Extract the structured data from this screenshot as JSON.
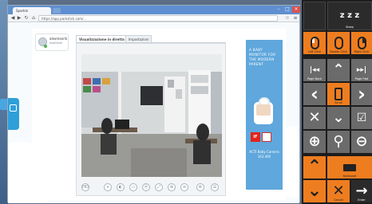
{
  "browser": {
    "tab_title": "Sparkle",
    "url": "https://app.parkstick.com/...",
    "window_controls": [
      "–",
      "□",
      "×"
    ],
    "nav": {
      "back": "◀",
      "forward": "▶",
      "reload": "↻",
      "home": "⌂"
    },
    "menu_icon": "≡"
  },
  "profile": {
    "name": "alexmanrik",
    "status": "Available"
  },
  "tabs": [
    "Visualizzazione in diretta",
    "Impostazioni"
  ],
  "video_controls": [
    "HD",
    "⏸",
    "◐",
    "▭",
    "⦿",
    "⤢",
    "⊕",
    "≡",
    "⚙",
    "☰"
  ],
  "ad": {
    "headline": "A BABY MONITOR FOR THE MODERN PARENT",
    "badge": "iF",
    "price_text": "ACTI Baby Camera 163.40€"
  },
  "panel": {
    "sleep": {
      "label": "z z z",
      "sub": "Sleep"
    },
    "left_click": {
      "sub": "Left Click"
    },
    "double_click": {
      "sub": "Double Click"
    },
    "right_click": {
      "sub": "Right Click"
    },
    "page_back": {
      "glyph": "|◂◂",
      "sub": "Page Back"
    },
    "up": {
      "glyph": "⌃"
    },
    "page_forward": {
      "glyph": "▸▸|",
      "sub": "Page Fwd"
    },
    "left": {
      "glyph": "‹"
    },
    "scroll": {
      "sub": "Scroll"
    },
    "right": {
      "glyph": "›"
    },
    "close": {
      "glyph": "✕"
    },
    "down": {
      "glyph": "⌄"
    },
    "check": {
      "glyph": "☑"
    },
    "zoom_in": {
      "glyph": "⊕"
    },
    "magnify": {
      "glyph": "⚲"
    },
    "zoom_out": {
      "glyph": "⊖"
    },
    "scroll_up": {
      "glyph": "⌃"
    },
    "keyboard": {
      "sub": "Keyboard"
    },
    "scroll_down": {
      "glyph": "⌄"
    },
    "cancel": {
      "glyph": "✕",
      "sub": "Cancel"
    },
    "enter": {
      "glyph": "→",
      "sub": "Enter"
    }
  }
}
